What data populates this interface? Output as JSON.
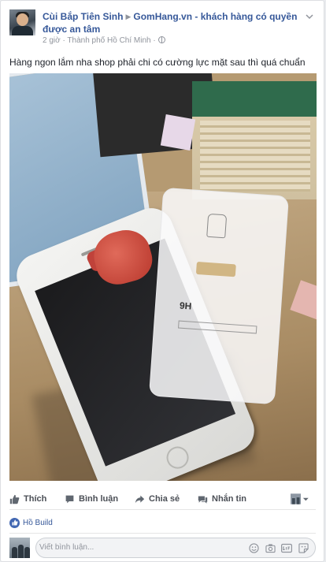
{
  "post": {
    "author": "Cùi Bắp Tiên Sinh",
    "group": "GomHang.vn - khách hàng có quyền được an tâm",
    "time": "2 giờ",
    "location": "Thành phố Hồ Chí Minh",
    "text": "Hàng ngon lắm nha shop phải chi có cường lực mặt sau thì quá chuẩn",
    "photo_text": "9H"
  },
  "actions": {
    "like": "Thích",
    "comment": "Bình luận",
    "share": "Chia sẻ",
    "send": "Nhắn tin"
  },
  "reactions": {
    "names": "Hồ Build"
  },
  "comment_box": {
    "placeholder": "Viết bình luận..."
  },
  "colors": {
    "link": "#365899",
    "accent": "#4267b2",
    "muted": "#90949c",
    "action_text": "#4b4f56"
  },
  "icons": [
    "globe-icon",
    "chevron-down-icon",
    "like-icon",
    "comment-icon",
    "share-icon",
    "messenger-icon",
    "emoji-icon",
    "camera-icon",
    "gif-icon",
    "sticker-icon"
  ]
}
